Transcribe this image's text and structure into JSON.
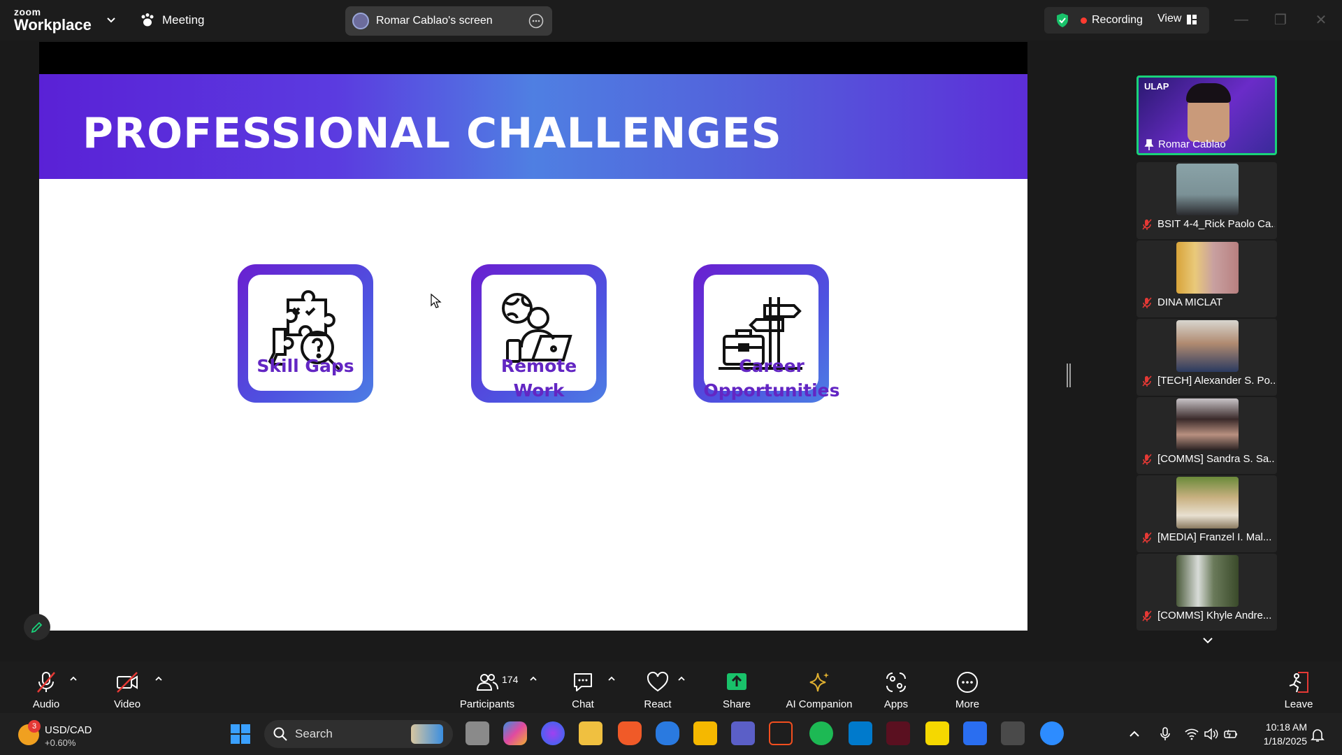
{
  "titlebar": {
    "brand_small": "zoom",
    "brand_big": "Workplace",
    "meeting_label": "Meeting",
    "screen_share_label": "Romar Cablao's screen",
    "recording_label": "Recording",
    "view_label": "View"
  },
  "slide": {
    "title": "PROFESSIONAL CHALLENGES",
    "cards": [
      {
        "line1": "Skill Gaps",
        "line2": ""
      },
      {
        "line1": "Remote",
        "line2": "Work"
      },
      {
        "line1": "Career",
        "line2": "Opportunities"
      }
    ]
  },
  "gallery": {
    "active": {
      "name": "Romar Cablao",
      "banner": "ULAP"
    },
    "participants": [
      {
        "name": "BSIT 4-4_Rick Paolo Ca..."
      },
      {
        "name": "DINA MICLAT"
      },
      {
        "name": "[TECH] Alexander S. Po..."
      },
      {
        "name": "[COMMS] Sandra S. Sa..."
      },
      {
        "name": "[MEDIA] Franzel I. Mal..."
      },
      {
        "name": "[COMMS] Khyle Andre..."
      }
    ]
  },
  "toolbar": {
    "audio": "Audio",
    "video": "Video",
    "participants": "Participants",
    "participants_count": "174",
    "chat": "Chat",
    "react": "React",
    "share": "Share",
    "ai_companion": "AI Companion",
    "apps": "Apps",
    "more": "More",
    "leave": "Leave"
  },
  "taskbar": {
    "ticker": "USD/CAD",
    "ticker_change": "+0.60%",
    "notification_count": "3",
    "search_placeholder": "Search",
    "time": "10:18 AM",
    "date": "1/18/2025"
  },
  "colors": {
    "accent_green": "#19d27a",
    "recording_red": "#ff3b30",
    "slide_purple": "#6326c3",
    "share_green": "#19c26a"
  }
}
